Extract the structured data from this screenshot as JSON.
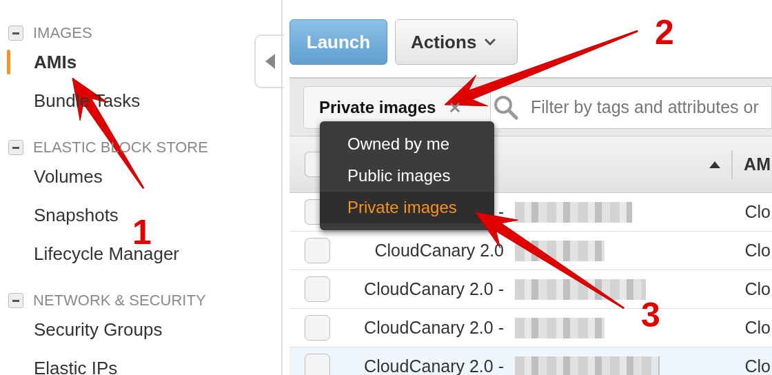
{
  "sidebar": {
    "sections": [
      {
        "title": "IMAGES",
        "expanded": true,
        "items": [
          {
            "label": "AMIs",
            "selected": true
          },
          {
            "label": "Bundle Tasks",
            "selected": false
          }
        ]
      },
      {
        "title": "ELASTIC BLOCK STORE",
        "expanded": true,
        "items": [
          {
            "label": "Volumes",
            "selected": false
          },
          {
            "label": "Snapshots",
            "selected": false
          },
          {
            "label": "Lifecycle Manager",
            "selected": false
          }
        ]
      },
      {
        "title": "NETWORK & SECURITY",
        "expanded": true,
        "items": [
          {
            "label": "Security Groups",
            "selected": false
          },
          {
            "label": "Elastic IPs",
            "selected": false
          }
        ]
      }
    ]
  },
  "toolbar": {
    "buttons": [
      {
        "label": "Launch",
        "kind": "primary"
      },
      {
        "label": "Actions",
        "kind": "dropdown"
      }
    ]
  },
  "filter": {
    "token": "Private images",
    "search": {
      "placeholder": "Filter by tags and attributes or"
    }
  },
  "dropdown": {
    "options": [
      {
        "label": "Owned by me",
        "selected": false
      },
      {
        "label": "Public images",
        "selected": false
      },
      {
        "label": "Private images",
        "selected": true
      }
    ]
  },
  "table": {
    "header": {
      "select_all": {
        "checked": false
      },
      "column_3": "AM"
    },
    "rows": [
      {
        "name": "-",
        "column_3": "Clo",
        "checked": false,
        "highlighted": false
      },
      {
        "name": "CloudCanary 2.0",
        "column_3": "Clo",
        "checked": false,
        "highlighted": false
      },
      {
        "name": "CloudCanary 2.0 -",
        "column_3": "Clo",
        "checked": false,
        "highlighted": false
      },
      {
        "name": "CloudCanary 2.0 -",
        "column_3": "Clo",
        "checked": false,
        "highlighted": false
      },
      {
        "name": "CloudCanary 2.0 -",
        "column_3": "Clo",
        "checked": false,
        "highlighted": true
      }
    ]
  },
  "annotations": [
    {
      "number": "1"
    },
    {
      "number": "2"
    },
    {
      "number": "3"
    }
  ]
}
